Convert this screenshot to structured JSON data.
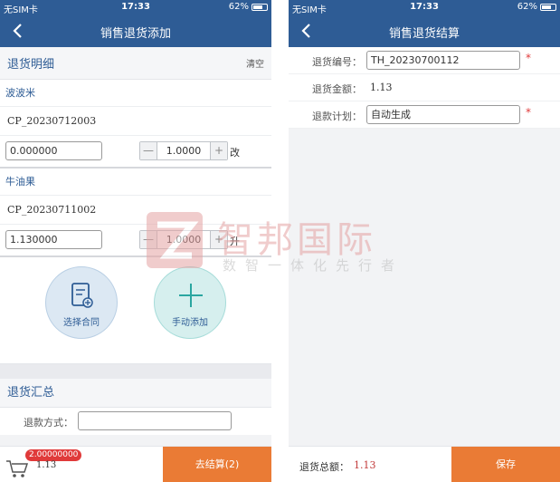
{
  "status_bar": {
    "carrier": "无SIM卡",
    "time": "17:33",
    "battery": "62%"
  },
  "left_screen": {
    "title": "销售退货添加",
    "detail_header": "退货明细",
    "clear_label": "清空",
    "items": [
      {
        "name": "波波米",
        "code": "CP_20230712003",
        "price": "0.000000",
        "quantity": "1.0000",
        "unit": "改"
      },
      {
        "name": "牛油果",
        "code": "CP_20230711002",
        "price": "1.130000",
        "quantity": "1.0000",
        "unit": "升"
      }
    ],
    "stepper_minus": "—",
    "stepper_plus": "+",
    "select_contract_label": "选择合同",
    "manual_add_label": "手动添加",
    "summary_header": "退货汇总",
    "refund_method_label": "退款方式：",
    "cart_badge": "2.00000000",
    "cart_amount": "1.13",
    "settle_label": "去结算(2)"
  },
  "right_screen": {
    "title": "销售退货结算",
    "return_no_label": "退货编号：",
    "return_no_value": "TH_20230700112",
    "return_amount_label": "退货金额：",
    "return_amount_value": "1.13",
    "refund_plan_label": "退款计划：",
    "refund_plan_value": "自动生成",
    "required_mark": "*",
    "total_label": "退货总额：",
    "total_value": "1.13",
    "save_label": "保存"
  },
  "watermark": {
    "brand": "智邦国际",
    "slogan": "数智一体化先行者"
  },
  "colors": {
    "nav": "#2e5c95",
    "accent": "#ea7b35",
    "required": "#e03a3a"
  }
}
